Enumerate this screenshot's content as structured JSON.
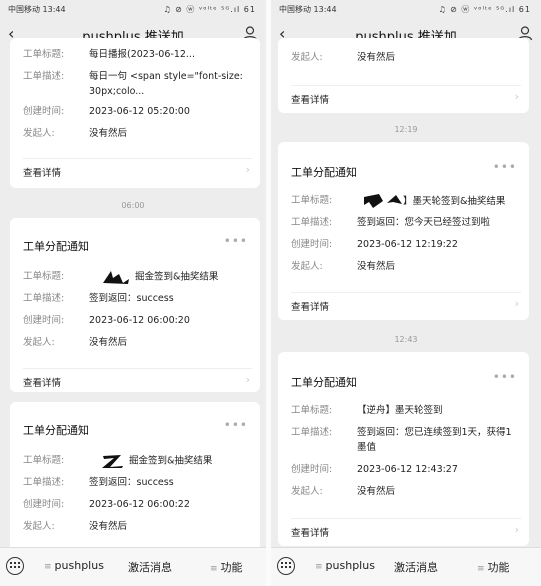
{
  "status": {
    "carrier": "中国移动 13:44",
    "icons": "♫ ⊘ ⓦ ᵛᵒˡᵗᵉ ⁵ᴳ.ıl 61"
  },
  "nav": {
    "title": "pushplus 推送加"
  },
  "labels": {
    "card_title": "工单分配通知",
    "title_key": "工单标题:",
    "desc_key": "工单描述:",
    "time_key": "创建时间:",
    "by_key": "发起人:",
    "detail": "查看详情"
  },
  "left": {
    "top_card": {
      "title_val": "每日播报(2023-06-12...",
      "desc_val": "每日一句 <span style=\"font-size: 30px;colo...",
      "time_val": "2023-06-12 05:20:00",
      "by_val": "没有然后"
    },
    "time1": "06:00",
    "card2": {
      "title_val": "掘金签到&抽奖结果",
      "desc_val": "签到返回：success",
      "time_val": "2023-06-12 06:00:20",
      "by_val": "没有然后"
    },
    "card3": {
      "title_val": "掘金签到&抽奖结果",
      "desc_val": "签到返回：success",
      "time_val": "2023-06-12 06:00:22",
      "by_val": "没有然后"
    }
  },
  "right": {
    "top_card": {
      "by_val": "没有然后"
    },
    "time1": "12:19",
    "card2": {
      "title_val": "】墨天轮签到&抽奖结果",
      "desc_val": "签到返回：您今天已经签过到啦",
      "time_val": "2023-06-12 12:19:22",
      "by_val": "没有然后"
    },
    "time2": "12:43",
    "card3": {
      "title_val": "【逆舟】墨天轮签到",
      "desc_val": "签到返回：您已连续签到1天，获得1墨值",
      "time_val": "2023-06-12 12:43:27",
      "by_val": "没有然后"
    }
  },
  "tabbar": {
    "menu1": "pushplus",
    "menu2": "激活消息",
    "menu3": "功能"
  }
}
